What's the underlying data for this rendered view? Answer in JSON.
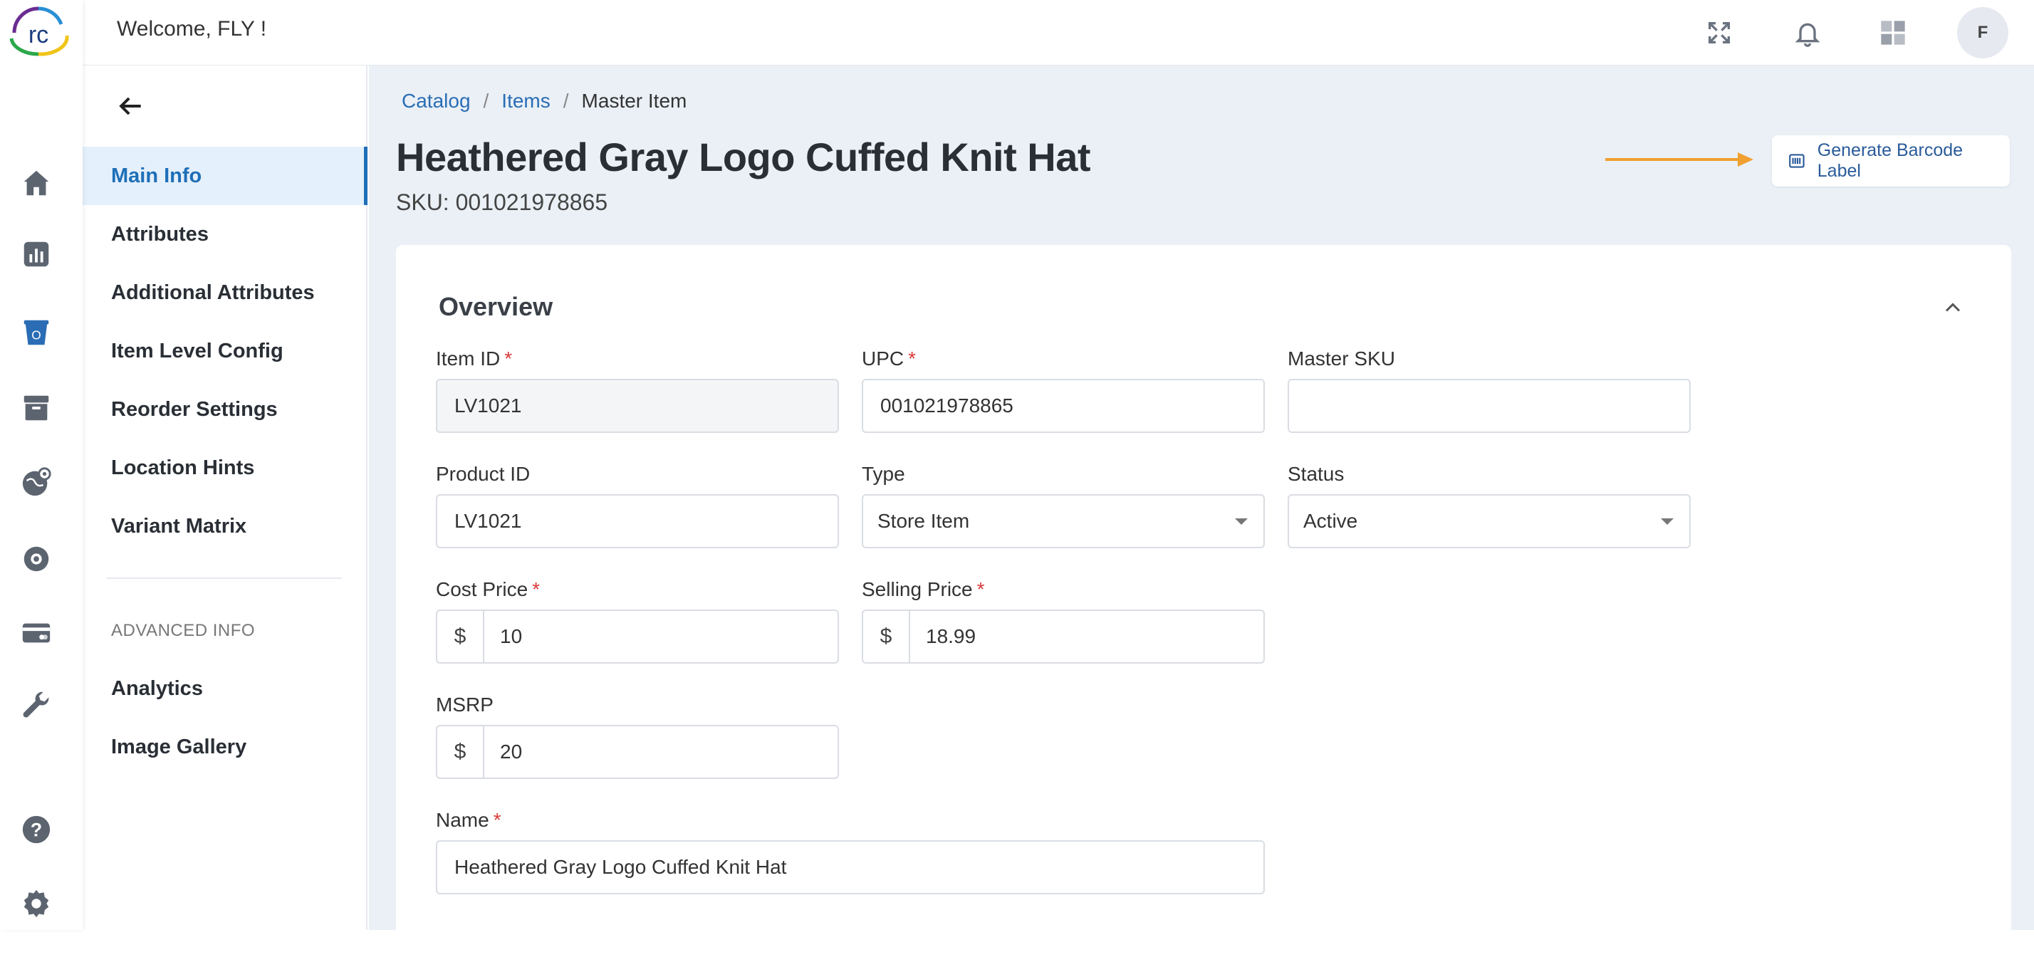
{
  "app": {
    "logo_text": "rc",
    "welcome": "Welcome, FLY !",
    "avatar_initial": "F"
  },
  "rail": {
    "items": [
      {
        "icon": "home-icon"
      },
      {
        "icon": "analytics-chart-icon"
      },
      {
        "icon": "catalog-bucket-icon",
        "active": true
      },
      {
        "icon": "archive-box-icon"
      },
      {
        "icon": "globe-location-icon"
      },
      {
        "icon": "badge-gear-icon"
      },
      {
        "icon": "card-payment-icon"
      },
      {
        "icon": "wrench-icon"
      },
      {
        "icon": "help-icon"
      },
      {
        "icon": "settings-gear-icon"
      }
    ],
    "color": "#5c6470",
    "active_color": "#2a6db5"
  },
  "sidenav": {
    "items": [
      {
        "label": "Main Info",
        "active": true
      },
      {
        "label": "Attributes"
      },
      {
        "label": "Additional Attributes"
      },
      {
        "label": "Item Level Config"
      },
      {
        "label": "Reorder Settings"
      },
      {
        "label": "Location Hints"
      },
      {
        "label": "Variant Matrix"
      }
    ],
    "advanced_section_label": "ADVANCED INFO",
    "advanced_items": [
      {
        "label": "Analytics"
      },
      {
        "label": "Image Gallery"
      }
    ]
  },
  "breadcrumb": {
    "items": [
      "Catalog",
      "Items"
    ],
    "current": "Master Item",
    "separator": "/"
  },
  "item": {
    "title": "Heathered Gray Logo Cuffed Knit Hat",
    "sku_line": "SKU: 001021978865"
  },
  "actions": {
    "barcode_label": "Generate Barcode Label",
    "arrow_color": "#f0a030"
  },
  "overview": {
    "title": "Overview",
    "item_id": {
      "label": "Item ID",
      "value": "LV1021",
      "required": "*"
    },
    "upc": {
      "label": "UPC",
      "value": "001021978865",
      "required": "*"
    },
    "master_sku": {
      "label": "Master SKU",
      "value": ""
    },
    "product_id": {
      "label": "Product ID",
      "value": "LV1021"
    },
    "type": {
      "label": "Type",
      "value": "Store Item"
    },
    "status": {
      "label": "Status",
      "value": "Active"
    },
    "cost_price": {
      "label": "Cost Price",
      "prefix": "$",
      "value": "10",
      "required": "*"
    },
    "selling_price": {
      "label": "Selling Price",
      "prefix": "$",
      "value": "18.99",
      "required": "*"
    },
    "msrp": {
      "label": "MSRP",
      "prefix": "$",
      "value": "20"
    },
    "name": {
      "label": "Name",
      "value": "Heathered Gray Logo Cuffed Knit Hat",
      "required": "*"
    }
  }
}
